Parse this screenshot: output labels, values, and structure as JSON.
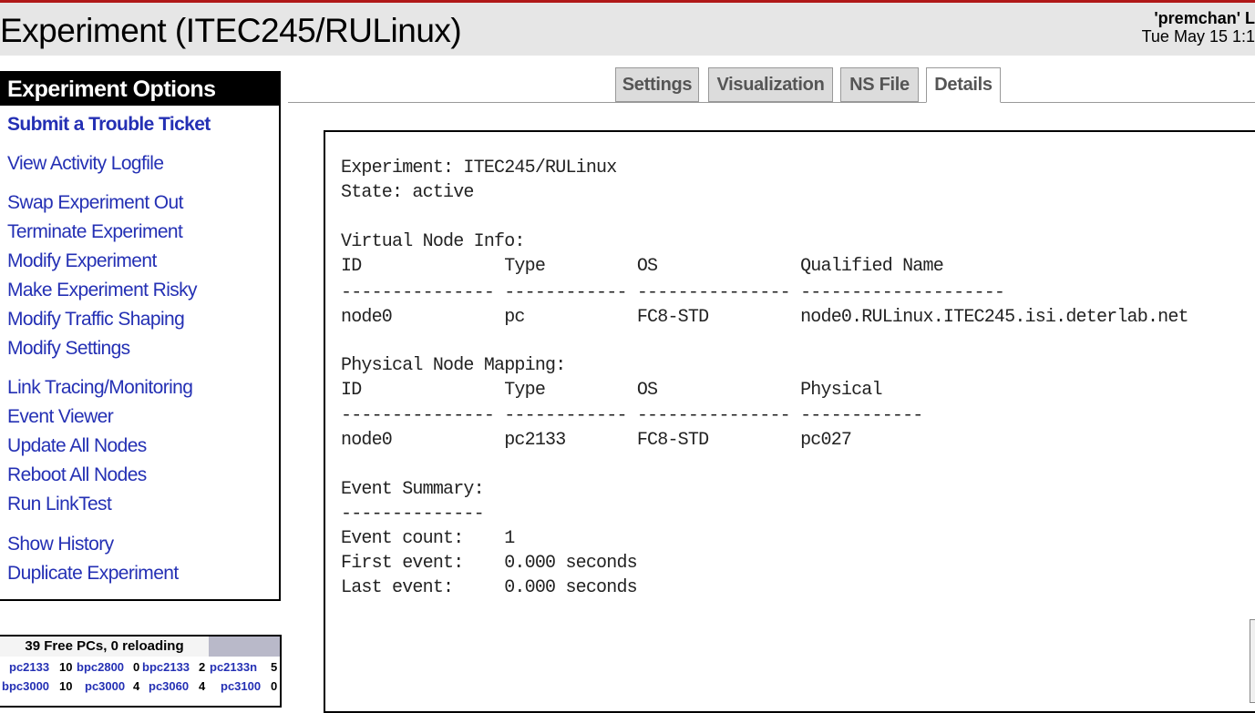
{
  "header": {
    "title": "Experiment (ITEC245/RULinux)",
    "user": "'premchan' L",
    "datetime": "Tue May 15 1:1"
  },
  "menu": {
    "title": "Experiment Options",
    "items": [
      {
        "label": "Submit a Trouble Ticket",
        "bold": true
      },
      {
        "label": "View Activity Logfile"
      },
      {
        "label": "Swap Experiment Out"
      },
      {
        "label": "Terminate Experiment"
      },
      {
        "label": "Modify Experiment"
      },
      {
        "label": "Make Experiment Risky"
      },
      {
        "label": "Modify Traffic Shaping"
      },
      {
        "label": "Modify Settings"
      },
      {
        "label": "Link Tracing/Monitoring"
      },
      {
        "label": "Event Viewer"
      },
      {
        "label": "Update All Nodes"
      },
      {
        "label": "Reboot All Nodes"
      },
      {
        "label": "Run LinkTest"
      },
      {
        "label": "Show History"
      },
      {
        "label": "Duplicate Experiment"
      }
    ]
  },
  "free_pcs": {
    "header": "39 Free PCs, 0 reloading",
    "rows": [
      [
        {
          "type": "pc2133",
          "count": "10"
        },
        {
          "type": "bpc2800",
          "count": "0"
        },
        {
          "type": "bpc2133",
          "count": "2"
        },
        {
          "type": "pc2133n",
          "count": "5"
        }
      ],
      [
        {
          "type": "bpc3000",
          "count": "10"
        },
        {
          "type": "pc3000",
          "count": "4"
        },
        {
          "type": "pc3060",
          "count": "4"
        },
        {
          "type": "pc3100",
          "count": "0"
        }
      ]
    ]
  },
  "tabs": [
    {
      "label": "Settings",
      "active": false
    },
    {
      "label": "Visualization",
      "active": false
    },
    {
      "label": "NS File",
      "active": false
    },
    {
      "label": "Details",
      "active": true
    }
  ],
  "details": {
    "experiment_line": "Experiment: ITEC245/RULinux",
    "state_line": "State: active",
    "virtual_heading": "Virtual Node Info:",
    "virtual_columns": "ID              Type         OS              Qualified Name",
    "virtual_sep": "--------------- ------------ --------------- --------------------",
    "virtual_row": "node0           pc           FC8-STD         node0.RULinux.ITEC245.isi.deterlab.net",
    "physical_heading": "Physical Node Mapping:",
    "physical_columns": "ID              Type         OS              Physical",
    "physical_sep": "--------------- ------------ --------------- ------------",
    "physical_row": "node0           pc2133       FC8-STD         pc027",
    "event_heading": "Event Summary:",
    "event_sep": "--------------",
    "event_count": "Event count:    1",
    "first_event": "First event:    0.000 seconds",
    "last_event": "Last event:     0.000 seconds"
  },
  "colors": {
    "link": "#2430b4",
    "topline": "#b01818",
    "header_bg": "#e6e6e6"
  }
}
